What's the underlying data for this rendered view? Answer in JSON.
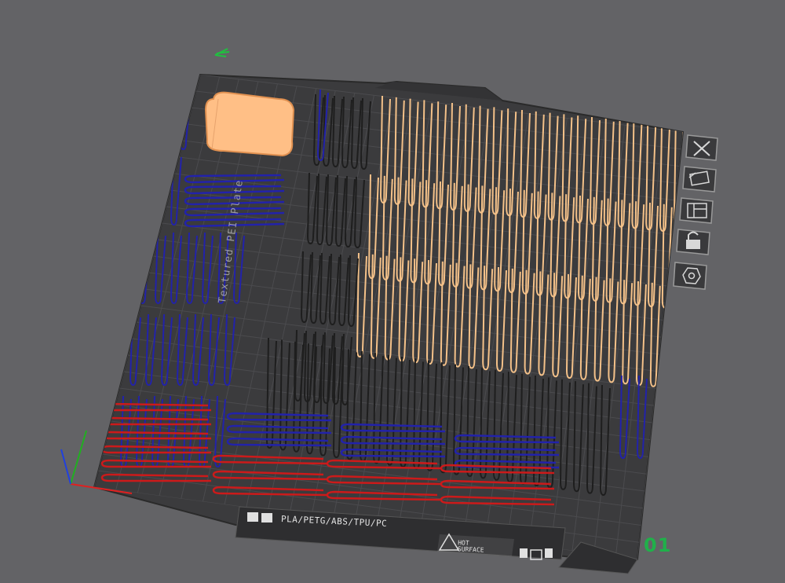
{
  "plate": {
    "number": "01",
    "filament_text": "PLA/PETG/ABS/TPU/PC",
    "hot_surface_line1": "HOT",
    "hot_surface_line2": "SURFACE"
  },
  "side_toolbar": {
    "buttons": [
      {
        "name": "remove-plate-button",
        "icon": "close-icon"
      },
      {
        "name": "auto-orient-button",
        "icon": "auto-orient-icon"
      },
      {
        "name": "arrange-button",
        "icon": "arrange-icon"
      },
      {
        "name": "lock-plate-button",
        "icon": "lock-icon"
      },
      {
        "name": "plate-settings-button",
        "icon": "settings-icon"
      }
    ]
  },
  "colors": {
    "background": "#636366",
    "bed": "#3b3b3d",
    "grid": "#4c4c4e",
    "model_blue": "#2222aa",
    "model_black": "#1e1e1e",
    "model_tan": "#f4c189",
    "model_red": "#cc1a1a",
    "selected_part": "#ffbf86",
    "plate_label": "#20b04a"
  }
}
